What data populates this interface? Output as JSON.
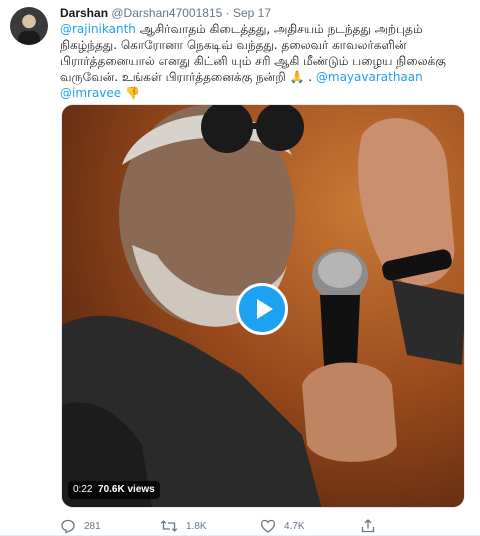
{
  "tweet": {
    "display_name": "Darshan",
    "handle": "@Darshan47001815",
    "separator": "·",
    "date": "Sep 17",
    "text": {
      "mention1": "@rajinikanth",
      "line1_rest": " ஆசிர்வாதம் கிடைத்தது, அதிசயம் நடந்தது அற்புதம் நிகழ்ந்தது. கொரோனா நெகடிவ் வந்தது. தலைவர் காவலர்களின் பிரார்த்தனையால் எனது கிட்னி யும் சரி ஆகி மீண்டும் பழைய நிலைக்கு வருவேன். உங்கள் பிரார்த்தனைக்கு நன்றி ",
      "emoji1": "🙏",
      "space": " . ",
      "mention2": "@mayavarathaan",
      "mention3": "@imravee",
      "emoji2": "👎"
    }
  },
  "media": {
    "duration": "0:22",
    "views": "70.6K views"
  },
  "actions": {
    "reply_count": "281",
    "retweet_count": "1.8K",
    "like_count": "4.7K"
  },
  "colors": {
    "accent": "#1da1f2",
    "secondary_text": "#657786"
  }
}
